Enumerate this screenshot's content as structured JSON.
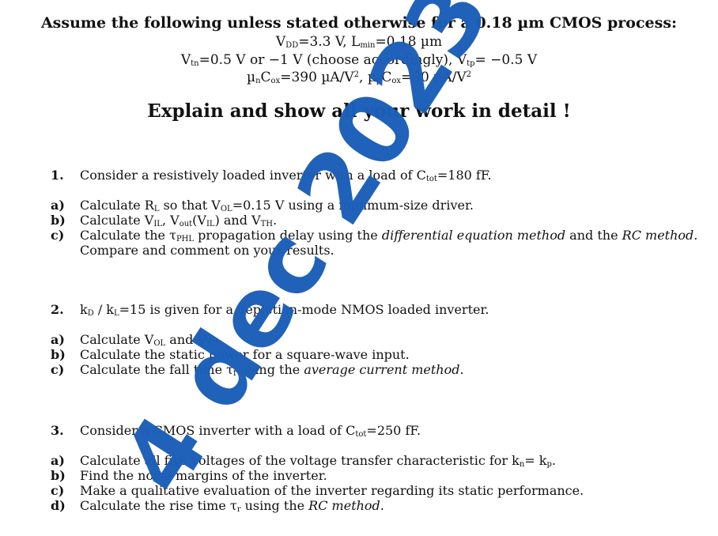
{
  "header": {
    "title": "Assume the following unless stated otherwise for a 0.18 µm CMOS process:",
    "params": {
      "line1": {
        "vdd_sym": "V",
        "vdd_sub": "DD",
        "vdd_val": "=3.3 V,  ",
        "lmin_sym": "L",
        "lmin_sub": "min",
        "lmin_val": "=0.18 µm"
      },
      "line2": {
        "vtn_sym": "V",
        "vtn_sub": "tn",
        "vtn_val": "=0.5 V  or  −1 V (choose accordingly),  ",
        "vtp_sym": "V",
        "vtp_sub": "tp",
        "vtp_val": "= −0.5 V"
      },
      "line3": {
        "un": "µ",
        "un_sub": "n",
        "cox": "C",
        "cox_sub": "ox",
        "un_val": "=390 µA/V",
        "sq": "2",
        "sep": ",  ",
        "up": "µ",
        "up_sub": "p",
        "cox2": "C",
        "cox2_sub": "ox",
        "up_val": "=90 µA/V",
        "sq2": "2"
      }
    },
    "instruction": "Explain and show all your work in detail !"
  },
  "problems": [
    {
      "number": "1.",
      "statement": {
        "pre": "Consider a resistively loaded inverter with a load of C",
        "sub": "tot",
        "post": "=180 fF."
      },
      "parts": {
        "a": {
          "label": "a)",
          "t1": "Calculate R",
          "s1": "L",
          "t2": " so that V",
          "s2": "OL",
          "t3": "=0.15 V using a minimum-size driver."
        },
        "b": {
          "label": "b)",
          "t1": "Calculate V",
          "s1": "IL",
          "t2": ", V",
          "s2": "out",
          "t3": "(V",
          "s3": "IL",
          "t4": ") and V",
          "s4": "TH",
          "t5": "."
        },
        "c": {
          "label": "c)",
          "t1": "Calculate the ",
          "tau": "τ",
          "s1": "PHL",
          "t2": " propagation delay using the ",
          "i1": "differential equation method",
          "t3": " and the ",
          "i2": "RC method.",
          "line2": "Compare and comment on your results."
        }
      }
    },
    {
      "number": "2.",
      "statement": {
        "t1": "k",
        "s1": "D",
        "t2": " / k",
        "s2": "L",
        "t3": "=15 is given for a depletion-mode NMOS loaded inverter."
      },
      "parts": {
        "a": {
          "label": "a)",
          "t1": "Calculate V",
          "s1": "OL",
          "t2": " and V",
          "s2": "TH",
          "t3": "."
        },
        "b": {
          "label": "b)",
          "text": "Calculate the static power for a square-wave input."
        },
        "c": {
          "label": "c)",
          "t1": "Calculate the fall time τ",
          "s1": "f",
          "t2": " using the ",
          "i1": "average current method",
          "t3": "."
        }
      }
    },
    {
      "number": "3.",
      "statement": {
        "pre": "Consider a CMOS inverter with a load of C",
        "sub": "tot",
        "post": "=250 fF."
      },
      "parts": {
        "a": {
          "label": "a)",
          "t1": "Calculate all five voltages of the voltage transfer characteristic for k",
          "s1": "n",
          "t2": "= k",
          "s2": "p",
          "t3": "."
        },
        "b": {
          "label": "b)",
          "text": "Find the noise margins of the inverter."
        },
        "c": {
          "label": "c)",
          "text": "Make a qualitative evaluation of the inverter regarding its static performance."
        },
        "d": {
          "label": "d)",
          "t1": "Calculate the rise time τ",
          "s1": "r",
          "t2": " using the ",
          "i1": "RC method",
          "t3": "."
        }
      }
    }
  ],
  "watermark": {
    "text": "4 dec 2023",
    "color": "#1c5fb8"
  }
}
